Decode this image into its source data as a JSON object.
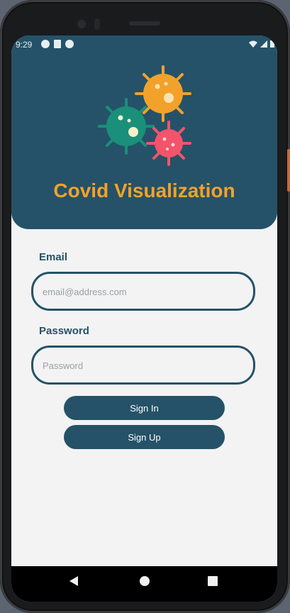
{
  "status_bar": {
    "time": "9:29",
    "left_icons": [
      "android-icon",
      "sd-card-icon",
      "sync-icon"
    ],
    "right_icons": [
      "wifi-icon",
      "signal-icon",
      "battery-icon"
    ]
  },
  "header": {
    "title": "Covid Visualization",
    "title_color": "#f2a22a",
    "background_color": "#255268",
    "logo_icon": "virus-cluster-icon",
    "virus_colors": [
      "#f2a22a",
      "#1a8f7a",
      "#f2546b"
    ]
  },
  "form": {
    "email_label": "Email",
    "email_placeholder": "email@address.com",
    "email_value": "",
    "password_label": "Password",
    "password_placeholder": "Password",
    "password_value": ""
  },
  "buttons": {
    "sign_in": "Sign In",
    "sign_up": "Sign Up"
  },
  "nav_bar": {
    "icons": [
      "back-icon",
      "home-icon",
      "recents-icon"
    ]
  },
  "accent_color": "#255268"
}
